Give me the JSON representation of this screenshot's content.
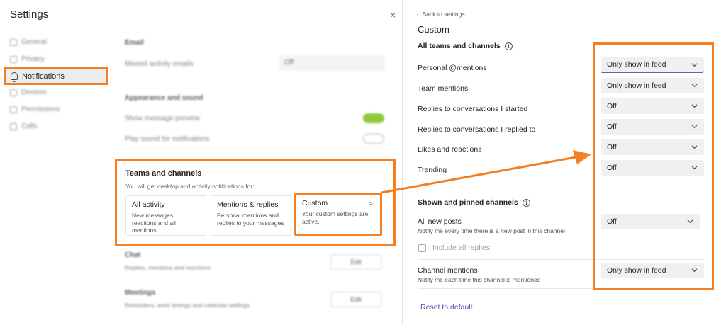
{
  "window": {
    "title": "Settings",
    "close_glyph": "×"
  },
  "sidebar": {
    "items": [
      {
        "label": "General",
        "icon": "gear-icon"
      },
      {
        "label": "Privacy",
        "icon": "lock-icon"
      },
      {
        "label": "Notifications",
        "icon": "bell-icon",
        "active": true
      },
      {
        "label": "Devices",
        "icon": "headset-icon"
      },
      {
        "label": "Permissions",
        "icon": "shield-icon"
      },
      {
        "label": "Calls",
        "icon": "phone-icon"
      }
    ]
  },
  "main": {
    "email": {
      "heading": "Email",
      "row_label": "Missed activity emails",
      "value": "Off"
    },
    "appearance": {
      "heading": "Appearance and sound",
      "preview_label": "Show message preview",
      "preview_on": true,
      "sound_label": "Play sound for notifications",
      "sound_on": false
    },
    "teams": {
      "heading": "Teams and channels",
      "subtitle": "You will get desktop and activity notifications for:",
      "cards": [
        {
          "title": "All activity",
          "desc": "New messages, reactions and all mentions"
        },
        {
          "title": "Mentions & replies",
          "desc": "Personal mentions and replies to your messages"
        },
        {
          "title": "Custom",
          "desc": "Your custom settings are active."
        }
      ],
      "custom_chevron": ">"
    },
    "chat": {
      "heading": "Chat",
      "desc": "Replies, mentions and reactions",
      "button": "Edit"
    },
    "meetings": {
      "heading": "Meetings",
      "desc": "Reminders, work timings and calendar settings",
      "button": "Edit"
    }
  },
  "custom_panel": {
    "back_label": "Back to settings",
    "title": "Custom",
    "section1": "All teams and channels",
    "rows": [
      {
        "label": "Personal @mentions",
        "value": "Only show in feed"
      },
      {
        "label": "Team mentions",
        "value": "Only show in feed"
      },
      {
        "label": "Replies to conversations I started",
        "value": "Off"
      },
      {
        "label": "Replies to conversations I replied to",
        "value": "Off"
      },
      {
        "label": "Likes and reactions",
        "value": "Off"
      },
      {
        "label": "Trending",
        "value": "Off"
      }
    ],
    "section2": "Shown and pinned channels",
    "all_new_posts": {
      "label": "All new posts",
      "desc": "Notify me every time there is a new post in this channel",
      "value": "Off"
    },
    "include_replies": {
      "label": "Include all replies",
      "checked": false
    },
    "channel_mentions": {
      "label": "Channel mentions",
      "desc": "Notify me each time this channel is mentioned",
      "value": "Only show in feed"
    },
    "reset_label": "Reset to default"
  },
  "colors": {
    "highlight": "#f57e20",
    "accent": "#5b5fc7",
    "link": "#4f52b2",
    "toggle_on": "#6bb700"
  }
}
